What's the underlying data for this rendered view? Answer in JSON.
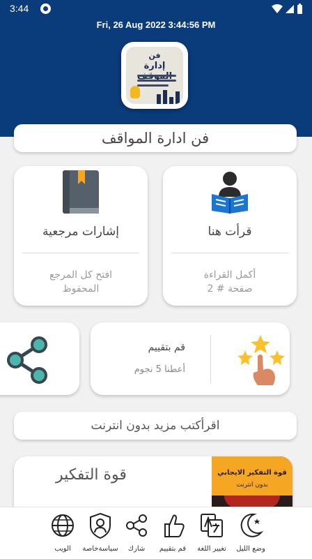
{
  "status_bar": {
    "time": "3:44"
  },
  "header": {
    "datetime": "Fri, 26  Aug  2022    3:44:56 PM"
  },
  "cover": {
    "line1": "فن",
    "line2": "إدارة الموقف"
  },
  "title": "فن ادارة المواقف",
  "cards": {
    "read_here": {
      "title": "قرأت هنا",
      "line1": "أكمل القراءة",
      "line2": "صفحة # 2"
    },
    "bookmarks": {
      "title": "إشارات مرجعية",
      "line1": "افتح كل المرجع",
      "line2": "المحفوظ"
    },
    "rate": {
      "title": "قم بتقييم",
      "subtitle": "أعطنا 5 نجوم"
    }
  },
  "offline_banner": "اقرأكتب مزيد بدون انترنت",
  "promo": {
    "title": "قوة التفكير",
    "book_line1": "قوة التفكير الايجابي",
    "book_line2": "بدون انترنت"
  },
  "bottom_nav": [
    {
      "label": "وضع الليل",
      "icon": "moon-icon"
    },
    {
      "label": "تغيير اللغة",
      "icon": "translate-icon"
    },
    {
      "label": "قم بتقييم",
      "icon": "thumbs-up-icon"
    },
    {
      "label": "شارك",
      "icon": "share-icon"
    },
    {
      "label": "سياسةخاصة",
      "icon": "shield-user-icon"
    },
    {
      "label": "الويب",
      "icon": "globe-icon"
    }
  ],
  "colors": {
    "header": "#0a3b7a",
    "accent_book": "#f5a623",
    "reader_blue": "#1976d2",
    "promo_red": "#b3261e"
  }
}
